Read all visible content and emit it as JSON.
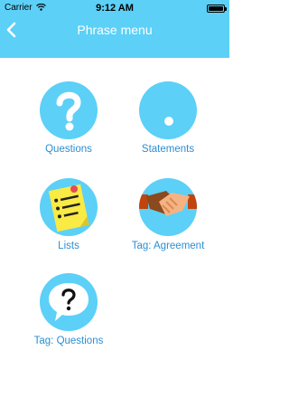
{
  "status_bar": {
    "carrier": "Carrier",
    "time": "9:12 AM"
  },
  "nav": {
    "title": "Phrase menu",
    "back_icon": "chevron-left-icon"
  },
  "tiles": [
    {
      "label": "Questions",
      "icon": "question-mark-icon"
    },
    {
      "label": "Statements",
      "icon": "period-dot-icon"
    },
    {
      "label": "Lists",
      "icon": "sticky-note-list-icon"
    },
    {
      "label": "Tag: Agreement",
      "icon": "handshake-icon"
    },
    {
      "label": "Tag: Questions",
      "icon": "speech-bubble-question-icon"
    }
  ],
  "colors": {
    "accent": "#5cd0f7",
    "label": "#2b8ed3"
  }
}
